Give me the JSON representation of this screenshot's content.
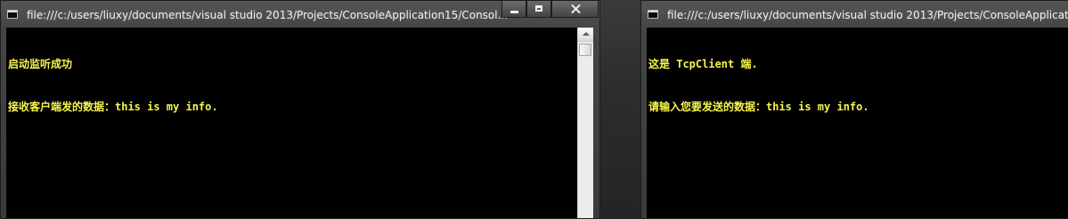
{
  "windows": {
    "left": {
      "title": "file:///c:/users/liuxy/documents/visual studio 2013/Projects/ConsoleApplication15/Consol...",
      "lines": [
        "启动监听成功",
        "接收客户端发的数据：this is my info."
      ]
    },
    "right": {
      "title": "file:///c:/users/liuxy/documents/visual studio 2013/Projects/ConsoleApplication15/Consol...",
      "lines": [
        "这是 TcpClient 端.",
        "请输入您要发送的数据：this is my info."
      ]
    }
  },
  "colors": {
    "console_background": "#000000",
    "console_text": "#f7f54d",
    "titlebar": "#4f4f4f",
    "desktop": "#2a2b2d"
  },
  "icons": {
    "window_app": "console-window-icon",
    "minimize": "minimize-icon",
    "maximize": "maximize-icon",
    "close": "close-icon",
    "scroll_up": "scroll-up-icon"
  }
}
